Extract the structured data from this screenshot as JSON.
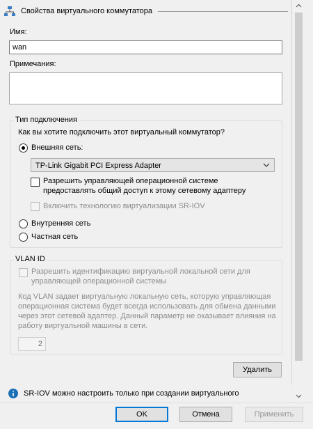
{
  "header": {
    "title": "Свойства виртуального коммутатора",
    "icon": "network-switch-icon"
  },
  "name": {
    "label": "Имя:",
    "value": "wan"
  },
  "notes": {
    "label": "Примечания:",
    "value": ""
  },
  "connection": {
    "legend": "Тип подключения",
    "question": "Как вы хотите подключить этот виртуальный коммутатор?",
    "external": {
      "label": "Внешняя сеть:",
      "checked": true
    },
    "adapter": {
      "selected": "TP-Link Gigabit PCI Express Adapter"
    },
    "allow_mgmt": {
      "label": "Разрешить управляющей операционной системе предоставлять общий доступ к этому сетевому адаптеру",
      "checked": false
    },
    "sriov": {
      "label": "Включить технологию виртуализации SR-IOV",
      "checked": false,
      "disabled": true
    },
    "internal": {
      "label": "Внутренняя сеть",
      "checked": false
    },
    "private": {
      "label": "Частная сеть",
      "checked": false
    }
  },
  "vlan": {
    "legend": "VLAN ID",
    "enable_label": "Разрешить идентификацию виртуальной локальной сети для управляющей операционной системы",
    "description": "Код VLAN задает виртуальную локальную сеть, которую управляющая операционная система будет всегда использовать для обмена данными через этот сетевой адаптер. Данный параметр не оказывает влияния на работу виртуальной машины в сети.",
    "value": "2"
  },
  "delete_label": "Удалить",
  "info": {
    "text": "SR-IOV можно настроить только при создании виртуального",
    "icon": "info-icon"
  },
  "footer": {
    "ok": "OK",
    "cancel": "Отмена",
    "apply": "Применить"
  },
  "colors": {
    "accent": "#0078d7",
    "info": "#1a6fb5"
  }
}
